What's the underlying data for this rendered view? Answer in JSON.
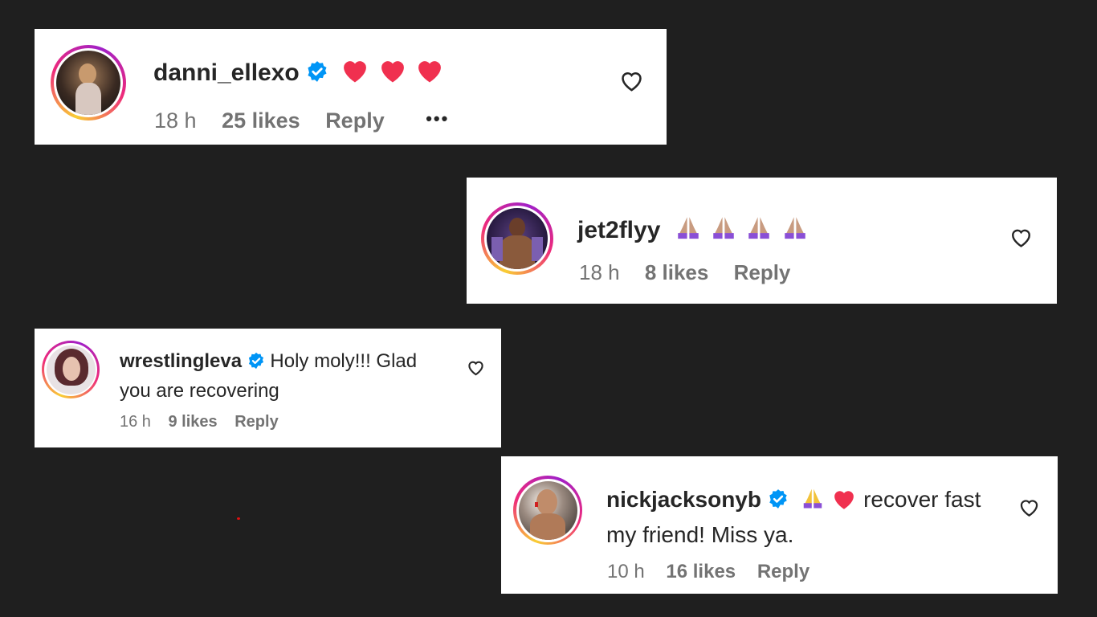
{
  "comments": [
    {
      "username": "danni_ellexo",
      "text": "",
      "emojis": [
        "red-heart",
        "red-heart",
        "red-heart"
      ],
      "time": "18 h",
      "likes": "25 likes",
      "reply": "Reply",
      "more": "•••"
    },
    {
      "username": "jet2flyy",
      "text": "",
      "emojis": [
        "folded-hands",
        "folded-hands",
        "folded-hands",
        "folded-hands"
      ],
      "time": "18 h",
      "likes": "8 likes",
      "reply": "Reply"
    },
    {
      "username": "wrestlingleva",
      "text_line1": "Holy moly!!! Glad",
      "text_line2": "you are recovering",
      "time": "16 h",
      "likes": "9 likes",
      "reply": "Reply"
    },
    {
      "username": "nickjacksonyb",
      "emojis": [
        "folded-hands",
        "red-heart"
      ],
      "text_line1": "recover fast",
      "text_line2": "my friend! Miss ya.",
      "time": "10 h",
      "likes": "16 likes",
      "reply": "Reply"
    }
  ],
  "colors": {
    "background": "#1f1f1f",
    "card": "#ffffff",
    "text": "#262626",
    "muted": "#737373",
    "verified": "#0095f6",
    "heart_emoji": "#f0304f",
    "hands_emoji": "#8a4fd6"
  },
  "icons": [
    "verified-badge-icon",
    "like-heart-icon",
    "red-heart-emoji",
    "folded-hands-emoji",
    "more-options-icon"
  ]
}
